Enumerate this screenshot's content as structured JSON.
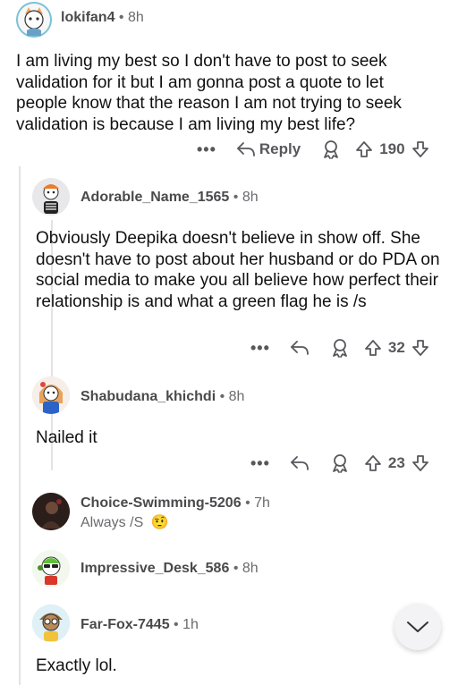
{
  "comments": [
    {
      "username": "lokifan4",
      "time": "8h",
      "body": "I am living my best so I don't have to post to seek validation for it but I am gonna post a quote to let people know that the reason I am not trying to seek validation is because I am living my best life?",
      "more": "•••",
      "reply_label": "Reply",
      "votes": "190",
      "avatar_bg": "#7cc3d8"
    },
    {
      "username": "Adorable_Name_1565",
      "time": "8h",
      "body": "Obviously Deepika doesn't believe in show off. She doesn't have to post about her husband or do PDA on social media to make you all believe how perfect their relationship is and what a green flag he is /s",
      "more": "•••",
      "votes": "32",
      "avatar_bg": "#e8e8ea"
    },
    {
      "username": "Shabudana_khichdi",
      "time": "8h",
      "body": "Nailed it",
      "more": "•••",
      "votes": "23",
      "avatar_bg": "#f0d9c8"
    },
    {
      "username": "Choice-Swimming-5206",
      "time": "7h",
      "collapsed_text": "Always /S",
      "emoji": "🤨",
      "avatar_bg": "#2a1d1a"
    },
    {
      "username": "Impressive_Desk_586",
      "time": "8h",
      "avatar_bg": "#e9f3e4"
    },
    {
      "username": "Far-Fox-7445",
      "time": "1h",
      "body": "Exactly lol.",
      "avatar_bg": "#b7dff0"
    }
  ],
  "separator": "•",
  "colors": {
    "text": "#1a1a1b",
    "meta": "#6b6b6f",
    "icons": "#58585c",
    "threadline": "#e3e3e6"
  }
}
